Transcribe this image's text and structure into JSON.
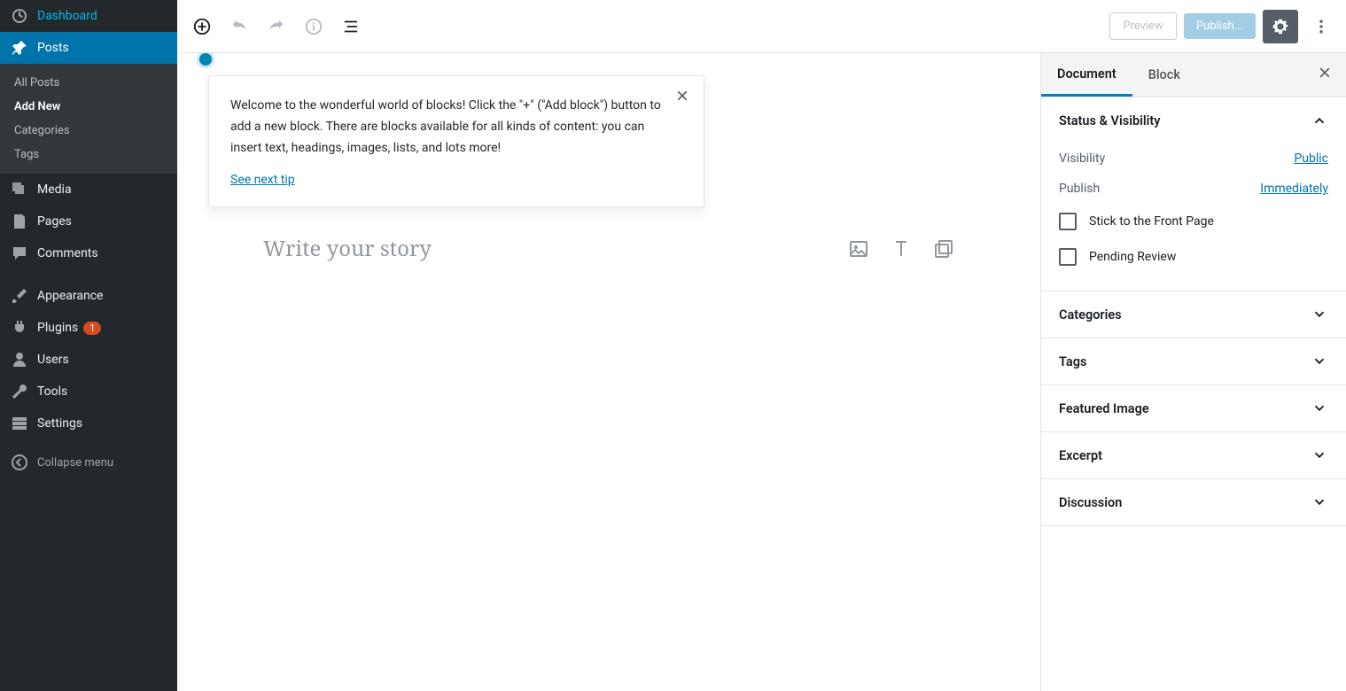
{
  "sidebar": {
    "dashboard": "Dashboard",
    "posts": "Posts",
    "submenu": {
      "all": "All Posts",
      "add_new": "Add New",
      "categories": "Categories",
      "tags": "Tags"
    },
    "media": "Media",
    "pages": "Pages",
    "comments": "Comments",
    "appearance": "Appearance",
    "plugins": "Plugins",
    "plugins_badge": "1",
    "users": "Users",
    "tools": "Tools",
    "settings": "Settings",
    "collapse": "Collapse menu"
  },
  "topbar": {
    "preview": "Preview",
    "publish": "Publish..."
  },
  "tip": {
    "text": "Welcome to the wonderful world of blocks! Click the \"+\" (\"Add block\") button to add a new block. There are blocks available for all kinds of content: you can insert text, headings, images, lists, and lots more!",
    "link": "See next tip"
  },
  "editor": {
    "placeholder": "Write your story"
  },
  "panel": {
    "tabs": {
      "document": "Document",
      "block": "Block"
    },
    "status": {
      "heading": "Status & Visibility",
      "visibility_label": "Visibility",
      "visibility_value": "Public",
      "publish_label": "Publish",
      "publish_value": "Immediately",
      "stick": "Stick to the Front Page",
      "pending": "Pending Review"
    },
    "categories": "Categories",
    "tags": "Tags",
    "featured": "Featured Image",
    "excerpt": "Excerpt",
    "discussion": "Discussion"
  }
}
